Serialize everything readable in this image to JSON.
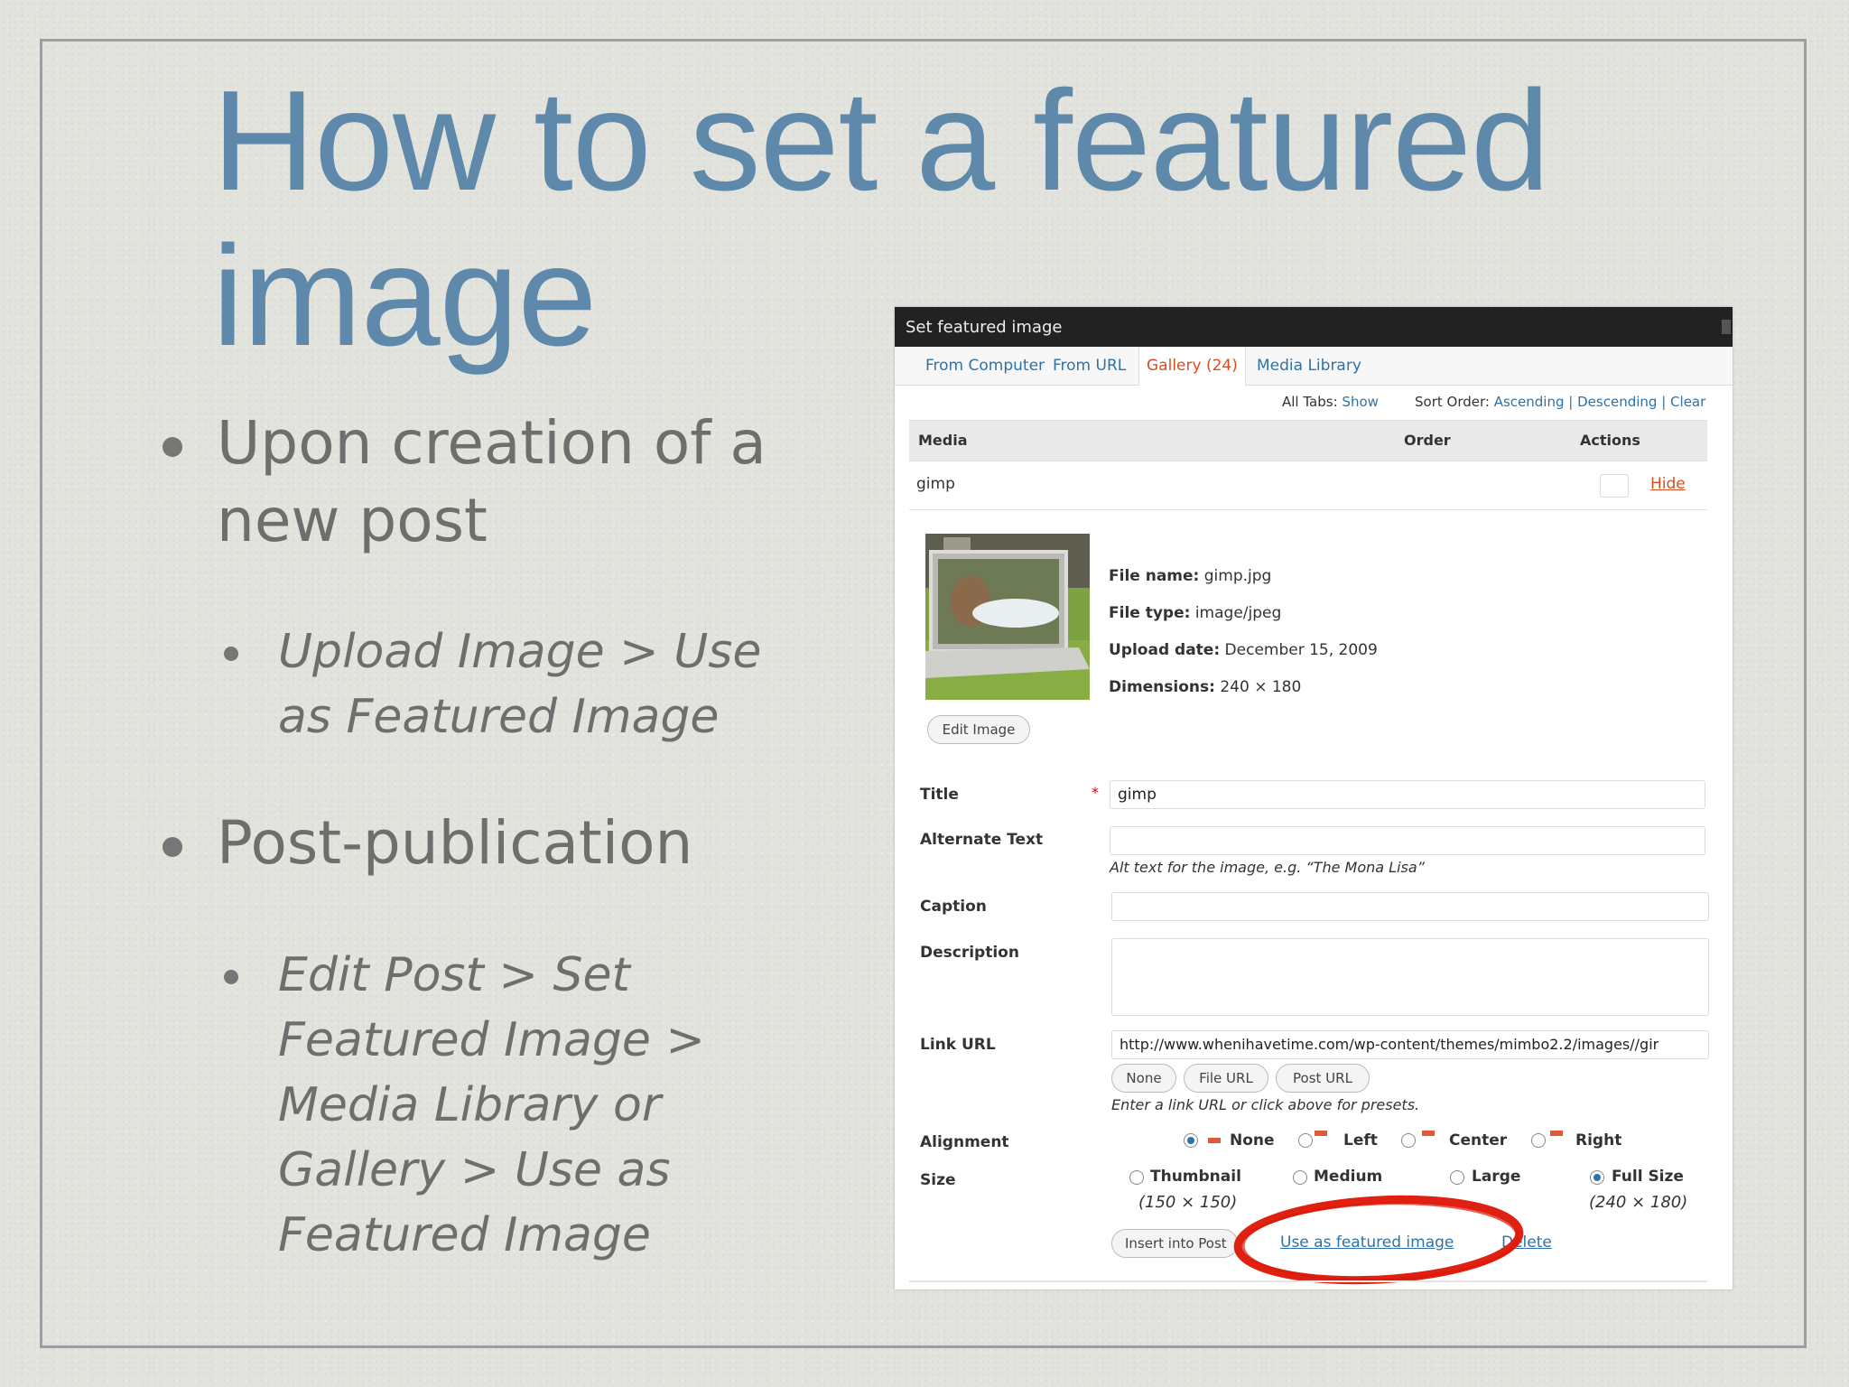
{
  "slide": {
    "title": "How to set a featured image",
    "bullets": [
      {
        "text": "Upon creation of a new post",
        "sub": "Upload Image > Use as Featured Image"
      },
      {
        "text": "Post-publication",
        "sub": "Edit Post >  Set Featured Image > Media Library or Gallery > Use as Featured Image"
      }
    ]
  },
  "dialog": {
    "title": "Set featured image",
    "tabs": [
      "From Computer",
      "From URL",
      "Gallery (24)",
      "Media Library"
    ],
    "active_tab": "Gallery (24)",
    "all_tabs_label": "All Tabs:",
    "all_tabs_show": "Show",
    "sort_order_label": "Sort Order:",
    "sort_ascending": "Ascending",
    "sort_sep1": "|",
    "sort_descending": "Descending",
    "sort_sep2": "|",
    "sort_clear": "Clear",
    "columns": {
      "media": "Media",
      "order": "Order",
      "actions": "Actions"
    },
    "item_name": "gimp",
    "hide_label": "Hide",
    "file_info": {
      "file_name_label": "File name:",
      "file_name": "gimp.jpg",
      "file_type_label": "File type:",
      "file_type": "image/jpeg",
      "upload_date_label": "Upload date:",
      "upload_date": "December 15, 2009",
      "dimensions_label": "Dimensions:",
      "dimensions": "240 × 180"
    },
    "edit_image_button": "Edit Image",
    "fields": {
      "title_label": "Title",
      "title_required": "*",
      "title_value": "gimp",
      "alt_label": "Alternate Text",
      "alt_value": "",
      "alt_hint": "Alt text for the image, e.g. “The Mona Lisa”",
      "caption_label": "Caption",
      "caption_value": "",
      "description_label": "Description",
      "description_value": "",
      "link_label": "Link URL",
      "link_value": "http://www.whenihavetime.com/wp-content/themes/mimbo2.2/images//gir",
      "link_buttons": [
        "None",
        "File URL",
        "Post URL"
      ],
      "link_hint": "Enter a link URL or click above for presets.",
      "alignment_label": "Alignment",
      "alignment_options": [
        "None",
        "Left",
        "Center",
        "Right"
      ],
      "alignment_selected": "None",
      "size_label": "Size",
      "size_options": [
        {
          "label": "Thumbnail",
          "dims": "(150 × 150)"
        },
        {
          "label": "Medium",
          "dims": ""
        },
        {
          "label": "Large",
          "dims": ""
        },
        {
          "label": "Full Size",
          "dims": "(240 × 180)"
        }
      ],
      "size_selected": "Full Size"
    },
    "insert_button": "Insert into Post",
    "use_featured_link": "Use as featured image",
    "delete_link": "Delete",
    "highlight_color": "#e02010",
    "link_color": "#2d73a8",
    "active_tab_color": "#d54e21"
  }
}
